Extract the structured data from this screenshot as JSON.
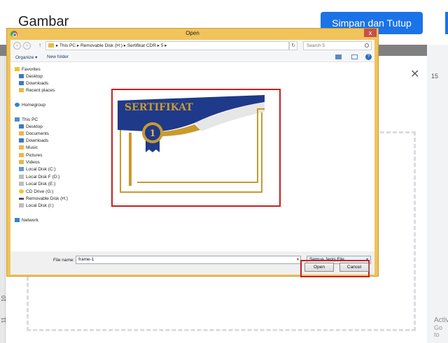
{
  "background": {
    "title": "Gambar",
    "save_button": "Simpan dan Tutup",
    "close_glyph": "✕",
    "ruler_numbers": [
      "10",
      "11"
    ],
    "right_number": "15",
    "activate_text": "Activ",
    "activate_sub": "Go to"
  },
  "dialog": {
    "title": "Open",
    "close_glyph": "x",
    "address": {
      "back": "‹",
      "forward": "›",
      "up": "↑",
      "path": "▸  This PC  ▸  Removable Disk (H:)  ▸  Sertifikat CDR  ▸  5  ▸",
      "refresh": "↻"
    },
    "search_placeholder": "Search 5",
    "toolbar": {
      "organize": "Organize ▾",
      "new_folder": "New folder",
      "help": "?"
    },
    "nav": {
      "favorites": "Favorites",
      "desktop": "Desktop",
      "downloads": "Downloads",
      "recent": "Recent places",
      "homegroup": "Homegroup",
      "this_pc": "This PC",
      "pc_desktop": "Desktop",
      "documents": "Documents",
      "pc_downloads": "Downloads",
      "music": "Music",
      "pictures": "Pictures",
      "videos": "Videos",
      "disk_c": "Local Disk (C:)",
      "disk_d": "Local Disk F (D:)",
      "disk_e": "Local Disk (E:)",
      "cd_g": "CD Drive (G:)",
      "removable_h": "Removable Disk (H:)",
      "disk_i": "Local Disk (I:)",
      "network": "Network"
    },
    "preview": {
      "cert_title": "SERTIFIKAT",
      "badge_number": "1"
    },
    "file_name_label": "File name:",
    "file_name_value": "frame-1",
    "file_type": "Semua Jenis File",
    "open_button": "Open",
    "cancel_button": "Cancel"
  },
  "colors": {
    "accent_blue": "#1a73e8",
    "highlight_red": "#c82020",
    "cert_blue": "#1f3a8a",
    "cert_gold": "#c99a2e"
  }
}
